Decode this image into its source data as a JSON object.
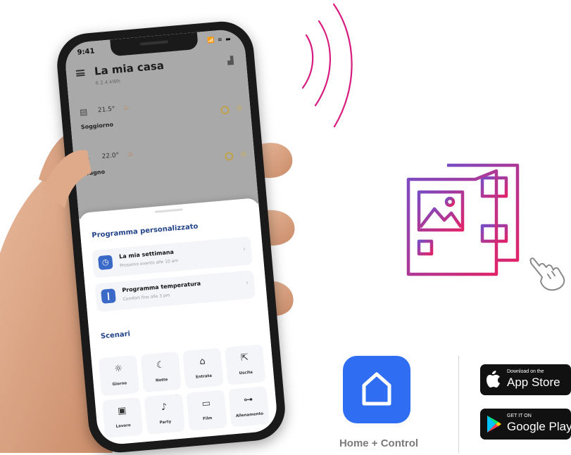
{
  "phone": {
    "status_time": "9:41",
    "status_icons": "📶 ≋ ▬",
    "title": "La mia casa",
    "subtitle": "6 2.4 kWh",
    "rooms": [
      {
        "temp": "21.5°",
        "name": "Soggiorno"
      },
      {
        "temp": "22.0°",
        "name": "Bagno"
      }
    ],
    "sections": {
      "program_title": "Programma personalizzato",
      "scenes_title": "Scenari"
    },
    "cards": [
      {
        "title": "La mia settimana",
        "sub": "Prossimo evento alle 10 am"
      },
      {
        "title": "Programma temperatura",
        "sub": "Comfort fino alle 3 pm"
      }
    ],
    "scenes": [
      {
        "label": "Giorno",
        "icon": "sun-icon"
      },
      {
        "label": "Notte",
        "icon": "moon-icon"
      },
      {
        "label": "Entrata",
        "icon": "enter-icon"
      },
      {
        "label": "Uscita",
        "icon": "exit-icon"
      },
      {
        "label": "Lavoro",
        "icon": "briefcase-icon"
      },
      {
        "label": "Party",
        "icon": "party-icon"
      },
      {
        "label": "Film",
        "icon": "tv-icon"
      },
      {
        "label": "Allenamento",
        "icon": "dumbbell-icon"
      }
    ]
  },
  "app": {
    "name": "Home + Control",
    "icon_color": "#2f6ef2"
  },
  "stores": {
    "apple": {
      "small": "Download on the",
      "big": "App Store"
    },
    "google": {
      "small": "GET IT ON",
      "big": "Google Play"
    }
  },
  "colors": {
    "wifi_arc": "#d81b7f",
    "accent_blue": "#3a69c8",
    "brochure_gradient_start": "#7a4cc4",
    "brochure_gradient_end": "#e0246a"
  }
}
